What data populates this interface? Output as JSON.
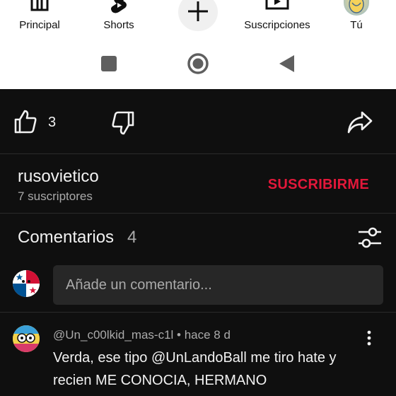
{
  "bottom_nav": {
    "items": [
      {
        "label": "Principal",
        "icon": "home-icon"
      },
      {
        "label": "Shorts",
        "icon": "shorts-icon"
      },
      {
        "label": "",
        "icon": "plus-icon"
      },
      {
        "label": "Suscripciones",
        "icon": "subscriptions-icon"
      },
      {
        "label": "Tú",
        "icon": "avatar"
      }
    ]
  },
  "system_nav": {
    "icons": [
      "recents-icon",
      "home-circle-icon",
      "back-icon"
    ]
  },
  "actions": {
    "like_count": "3"
  },
  "channel": {
    "name": "rusovietico",
    "subscribers": "7 suscriptores",
    "subscribe_label": "SUSCRIBIRME",
    "accent": "#e3183a"
  },
  "comments": {
    "title": "Comentarios",
    "count": "4",
    "add_placeholder": "Añade un comentario...",
    "items": [
      {
        "meta": "@Un_c00lkid_mas-c1l • hace 8 d",
        "text": "Verda, ese tipo @UnLandoBall me tiro hate y recien ME CONOCIA, HERMANO"
      }
    ]
  },
  "colors": {
    "background": "#0f0f0f",
    "surface": "#272727",
    "text": "#f1f1f1",
    "muted": "#aaaaaa"
  }
}
